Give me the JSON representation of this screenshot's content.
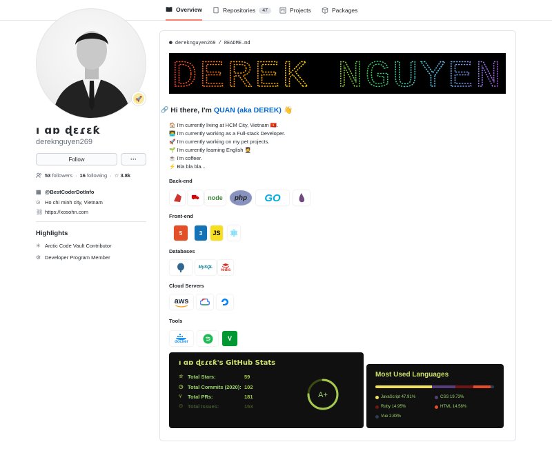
{
  "tabs": [
    {
      "label": "Overview",
      "icon": "book-icon",
      "active": true
    },
    {
      "label": "Repositories",
      "icon": "repo-icon",
      "count": "47"
    },
    {
      "label": "Projects",
      "icon": "project-icon"
    },
    {
      "label": "Packages",
      "icon": "package-icon"
    }
  ],
  "profile": {
    "name": "ı ɑɒ ɖɛɾɛƙ",
    "login": "dereknguyen269",
    "follow_label": "Follow",
    "more_label": "···",
    "followers_count": "53",
    "followers_label": "followers",
    "following_count": "16",
    "following_label": "following",
    "stars": "3.8k",
    "org": "@BestCoderDotInfo",
    "location": "Ho chi minh city, Vietnam",
    "website": "https://xosohn.com"
  },
  "highlights": {
    "title": "Highlights",
    "items": [
      "Arctic Code Vault Contributor",
      "Developer Program Member"
    ]
  },
  "readme": {
    "owner": "dereknguyen269",
    "sep": "/",
    "file": "README.md",
    "banner_text": "DEREK NGUYEN",
    "hi_prefix": "Hi there, I'm",
    "hi_name": "QUAN (aka DEREK)",
    "hi_emoji": "👋",
    "lines": [
      "🏠 I'm currently living at HCM City, Vietnam 🇻🇳.",
      "👨‍💻 I'm currently working as a Full-stack Developer.",
      "🚀 I'm currently working on my pet projects.",
      "🌱 I'm currently learning English 🧑‍🎓",
      "☕ I'm coffeer.",
      "⚡ Bla bla bla..."
    ],
    "sections": {
      "backend": "Back-end",
      "frontend": "Front-end",
      "databases": "Databases",
      "cloud": "Cloud Servers",
      "tools": "Tools"
    },
    "logos": {
      "backend": [
        "ruby",
        "rails",
        "node",
        "php",
        "GO",
        "elixir"
      ],
      "frontend": [
        "html5",
        "css3",
        "js",
        "react"
      ],
      "databases": [
        "postgresql",
        "mysql",
        "redis"
      ],
      "cloud": [
        "aws",
        "gcloud",
        "digitalocean"
      ],
      "tools": [
        "docker",
        "spotify",
        "vim"
      ]
    },
    "logo_text": {
      "node": "node",
      "php": "php",
      "GO": "GO",
      "js": "JS",
      "aws": "aws",
      "redis": "redis",
      "docker": "docker"
    }
  },
  "github_stats": {
    "title": "ı ɑɒ ɖɛɾɛƙ's GitHub Stats",
    "rows": [
      {
        "label": "Total Stars:",
        "value": "59"
      },
      {
        "label": "Total Commits (2020):",
        "value": "102"
      },
      {
        "label": "Total PRs:",
        "value": "181"
      },
      {
        "label": "Total Issues:",
        "value": "153"
      }
    ],
    "grade": "A+",
    "ring_fraction": 0.75
  },
  "languages": {
    "title": "Most Used Languages",
    "items": [
      {
        "name": "JavaScript 47.91%",
        "color": "#f1e05a",
        "pct": 47.91
      },
      {
        "name": "CSS 19.73%",
        "color": "#563d7c",
        "pct": 19.73
      },
      {
        "name": "Ruby 14.95%",
        "color": "#701516",
        "pct": 14.95
      },
      {
        "name": "HTML 14.58%",
        "color": "#e34c26",
        "pct": 14.58
      },
      {
        "name": "Vue 2.83%",
        "color": "#2c3e50",
        "pct": 2.83
      }
    ]
  }
}
